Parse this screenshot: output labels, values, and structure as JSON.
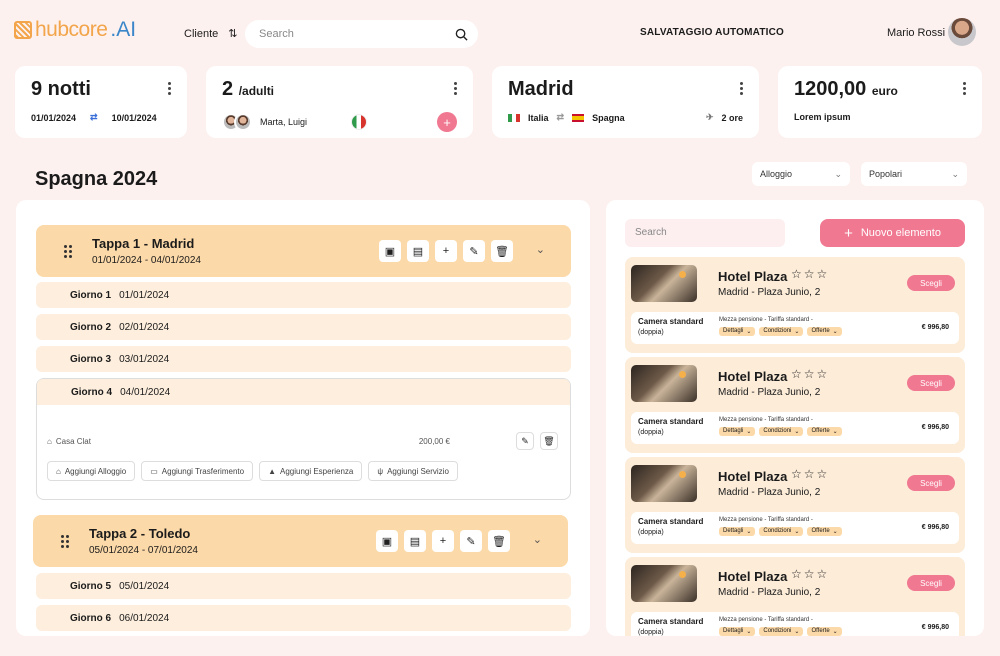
{
  "brand": {
    "name": "hubcore",
    "suffix": ".AI"
  },
  "header": {
    "cliente": "Cliente",
    "search_placeholder": "Search",
    "autosave": "SALVATAGGIO AUTOMATICO",
    "user": "Mario Rossi"
  },
  "stats": {
    "nights": {
      "value": "9 notti",
      "from": "01/01/2024",
      "to": "10/01/2024"
    },
    "adults": {
      "value": "2",
      "unit": "/adulti",
      "names": "Marta, Luigi"
    },
    "destination": {
      "value": "Madrid",
      "from": "Italia",
      "to": "Spagna",
      "duration": "2 ore"
    },
    "price": {
      "value": "1200,00",
      "unit": "euro",
      "note": "Lorem ipsum"
    }
  },
  "page_title": "Spagna 2024",
  "filters": {
    "alloggio": "Alloggio",
    "popolari": "Popolari"
  },
  "tappe": [
    {
      "title": "Tappa 1 - Madrid",
      "dates": "01/01/2024 - 04/01/2024"
    },
    {
      "title": "Tappa 2 - Toledo",
      "dates": "05/01/2024 - 07/01/2024"
    }
  ],
  "giorni": [
    {
      "label": "Giorno 1",
      "date": "01/01/2024"
    },
    {
      "label": "Giorno 2",
      "date": "02/01/2024"
    },
    {
      "label": "Giorno 3",
      "date": "03/01/2024"
    },
    {
      "label": "Giorno 4",
      "date": "04/01/2024"
    },
    {
      "label": "Giorno 5",
      "date": "05/01/2024"
    },
    {
      "label": "Giorno 6",
      "date": "06/01/2024"
    }
  ],
  "expanded_item": {
    "name": "Casa Clat",
    "price": "200,00 €"
  },
  "add_buttons": [
    "Aggiungi Alloggio",
    "Aggiungi Trasferimento",
    "Aggiungi Esperienza",
    "Aggiungi Servizio"
  ],
  "right_panel": {
    "search_placeholder": "Search",
    "new_button": "Nuovo elemento"
  },
  "hotels": [
    {
      "name": "Hotel Plaza",
      "location": "Madrid - Plaza Junio, 2",
      "select": "Scegli",
      "room": "Camera standard",
      "room_type": "(doppia)",
      "plan": "Mezza pensione - Tariffa standard -",
      "tags": [
        "Dettagli",
        "Condizioni",
        "Offerte"
      ],
      "price": "€ 996,80"
    },
    {
      "name": "Hotel Plaza",
      "location": "Madrid - Plaza Junio, 2",
      "select": "Scegli",
      "room": "Camera standard",
      "room_type": "(doppia)",
      "plan": "Mezza pensione - Tariffa standard -",
      "tags": [
        "Dettagli",
        "Condizioni",
        "Offerte"
      ],
      "price": "€ 996,80"
    },
    {
      "name": "Hotel Plaza",
      "location": "Madrid - Plaza Junio, 2",
      "select": "Scegli",
      "room": "Camera standard",
      "room_type": "(doppia)",
      "plan": "Mezza pensione - Tariffa standard -",
      "tags": [
        "Dettagli",
        "Condizioni",
        "Offerte"
      ],
      "price": "€ 996,80"
    },
    {
      "name": "Hotel Plaza",
      "location": "Madrid - Plaza Junio, 2",
      "select": "Scegli",
      "room": "Camera standard",
      "room_type": "(doppia)",
      "plan": "Mezza pensione - Tariffa standard -",
      "tags": [
        "Dettagli",
        "Condizioni",
        "Offerte"
      ],
      "price": "€ 996,80"
    }
  ],
  "colors": {
    "accent": "#f07891",
    "tappa": "#fcd9a8",
    "background": "#fdf1f0"
  }
}
